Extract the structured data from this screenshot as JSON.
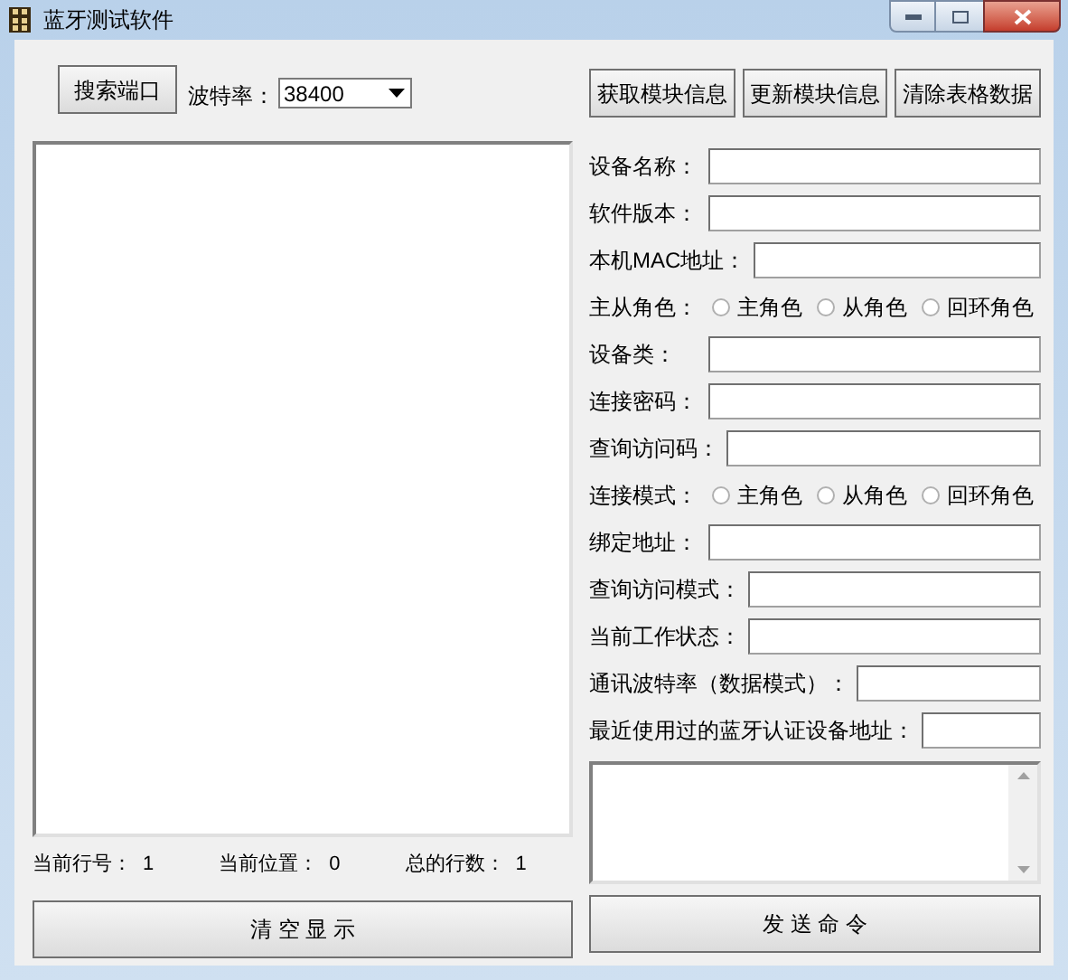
{
  "window": {
    "title": "蓝牙测试软件"
  },
  "toolbar": {
    "search_button": "搜索端口",
    "baud_label": "波特率：",
    "baud_value": "38400"
  },
  "actions": [
    "获取模块信息",
    "更新模块信息",
    "清除表格数据"
  ],
  "status": [
    {
      "label": "当前行号：",
      "value": "1"
    },
    {
      "label": "当前位置：",
      "value": "0"
    },
    {
      "label": "总的行数：",
      "value": "1"
    }
  ],
  "clear_button": "清 空 显 示",
  "form": [
    {
      "kind": "field",
      "label": "设备名称："
    },
    {
      "kind": "field",
      "label": "软件版本："
    },
    {
      "kind": "field",
      "label": "本机MAC地址："
    },
    {
      "kind": "radio",
      "label": "主从角色：",
      "options": [
        {
          "label": "主角色",
          "selected": false
        },
        {
          "label": "从角色",
          "selected": false
        },
        {
          "label": "回环角色",
          "selected": false
        }
      ]
    },
    {
      "kind": "field",
      "label": "设备类："
    },
    {
      "kind": "field",
      "label": "连接密码："
    },
    {
      "kind": "field",
      "label": "查询访问码："
    },
    {
      "kind": "radio",
      "label": "连接模式：",
      "options": [
        {
          "label": "主角色",
          "selected": false
        },
        {
          "label": "从角色",
          "selected": false
        },
        {
          "label": "回环角色",
          "selected": false
        }
      ]
    },
    {
      "kind": "field",
      "label": "绑定地址："
    },
    {
      "kind": "field",
      "label": "查询访问模式："
    },
    {
      "kind": "field",
      "label": "当前工作状态："
    },
    {
      "kind": "field",
      "label": "通讯波特率（数据模式）："
    },
    {
      "kind": "field",
      "label": "最近使用过的蓝牙认证设备地址："
    }
  ],
  "send_button": "发 送 命 令"
}
